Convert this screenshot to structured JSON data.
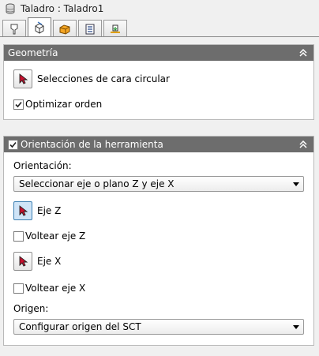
{
  "window": {
    "title": "Taladro : Taladro1",
    "icon": "drill-cylinder-icon"
  },
  "tabs": [
    {
      "icon": "tool-icon",
      "active": false
    },
    {
      "icon": "3d-box-orientation-icon",
      "active": true
    },
    {
      "icon": "stock-box-icon",
      "active": false
    },
    {
      "icon": "document-list-icon",
      "active": false
    },
    {
      "icon": "linking-icon",
      "active": false
    }
  ],
  "geometry": {
    "title": "Geometría",
    "circular_faces_label": "Selecciones de cara circular",
    "optimize_order_label": "Optimizar orden",
    "optimize_order_checked": true
  },
  "orientation": {
    "title": "Orientación de la herramienta",
    "enabled": true,
    "orientation_label": "Orientación:",
    "orientation_value": "Seleccionar eje o plano Z y eje X",
    "z_axis_label": "Eje Z",
    "flip_z_label": "Voltear eje Z",
    "flip_z_checked": false,
    "x_axis_label": "Eje X",
    "flip_x_label": "Voltear eje X",
    "flip_x_checked": false,
    "origin_label": "Origen:",
    "origin_value": "Configurar origen del SCT"
  },
  "colors": {
    "panel_header": "#6d6d6d",
    "cursor_red": "#c8102e",
    "selected_button": "#cfe4f7"
  }
}
